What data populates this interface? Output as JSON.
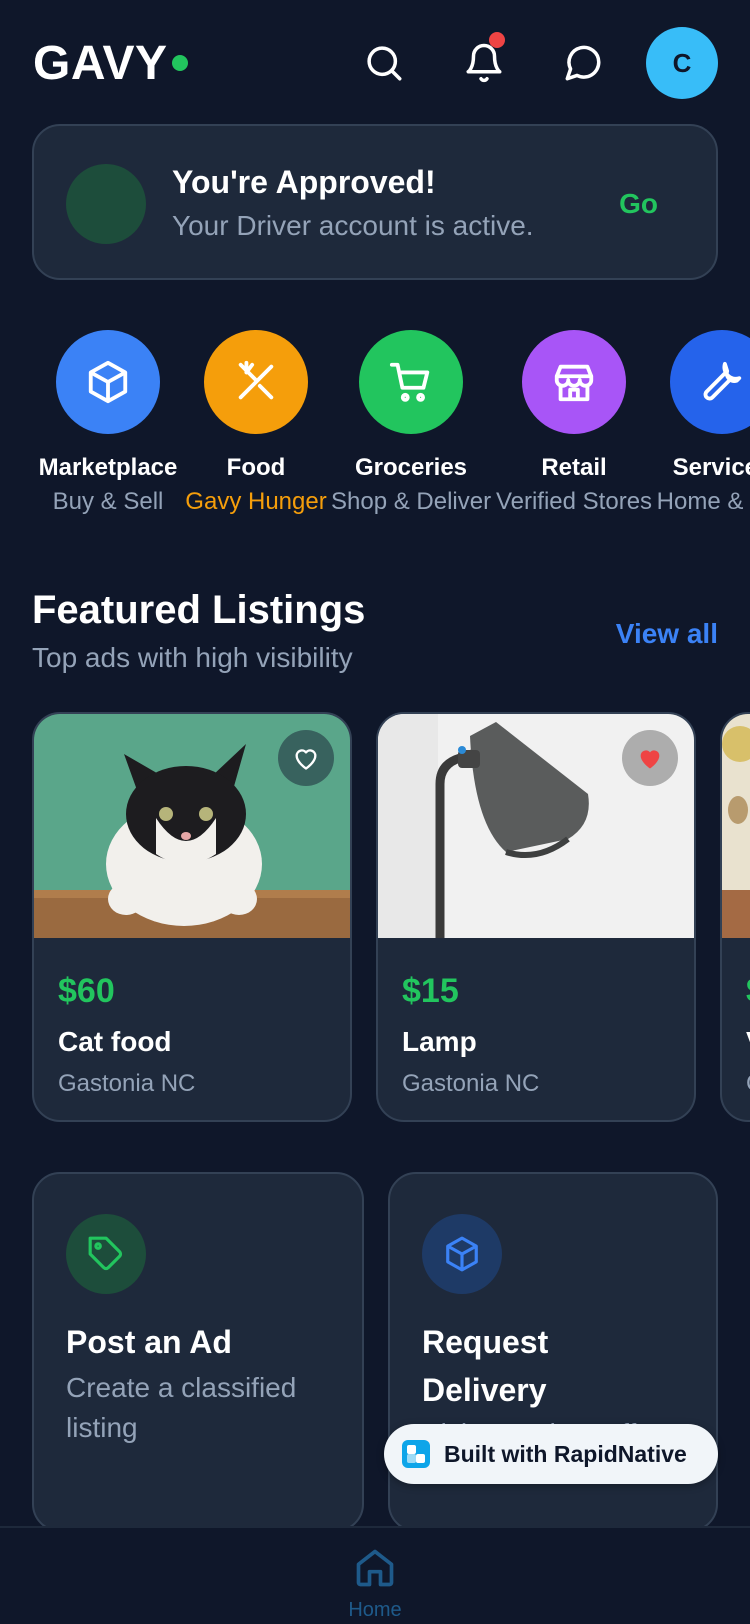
{
  "header": {
    "logo": "GAVY",
    "avatar_initial": "C",
    "icons": [
      "search-icon",
      "bell-icon",
      "chat-icon"
    ]
  },
  "approval": {
    "title": "You're Approved!",
    "subtitle": "Your Driver account is active.",
    "action": "Go"
  },
  "categories": [
    {
      "name": "Marketplace",
      "desc": "Buy & Sell",
      "icon": "box-icon",
      "color": "#3b82f6",
      "desc_color": "#94a3b8"
    },
    {
      "name": "Food",
      "desc": "Gavy Hunger",
      "icon": "utensils-icon",
      "color": "#f59e0b",
      "desc_color": "#f59e0b"
    },
    {
      "name": "Groceries",
      "desc": "Shop & Deliver",
      "icon": "cart-icon",
      "color": "#22c55e",
      "desc_color": "#94a3b8"
    },
    {
      "name": "Retail",
      "desc": "Verified Stores",
      "icon": "store-icon",
      "color": "#a855f7",
      "desc_color": "#94a3b8"
    },
    {
      "name": "Services",
      "desc": "Home & Pro",
      "icon": "wrench-icon",
      "color": "#2563eb",
      "desc_color": "#94a3b8"
    }
  ],
  "featured": {
    "title": "Featured Listings",
    "subtitle": "Top ads with high visibility",
    "view_all": "View all",
    "listings": [
      {
        "price": "$60",
        "title": "Cat food",
        "location": "Gastonia NC",
        "favorited": false
      },
      {
        "price": "$15",
        "title": "Lamp",
        "location": "Gastonia NC",
        "favorited": true
      },
      {
        "price": "$",
        "title": "V",
        "location": "G",
        "favorited": false
      }
    ]
  },
  "actions": [
    {
      "title": "Post an Ad",
      "subtitle": "Create a classified listing",
      "icon": "tag-icon"
    },
    {
      "title": "Request Delivery",
      "subtitle": "Pickup & drop-off",
      "icon": "box-icon"
    }
  ],
  "badge": {
    "label": "Built with RapidNative"
  },
  "tabbar": {
    "home_label": "Home"
  },
  "colors": {
    "bg": "#0f172a",
    "card": "#1e293b",
    "accent_green": "#22c55e",
    "accent_blue": "#3b82f6"
  }
}
